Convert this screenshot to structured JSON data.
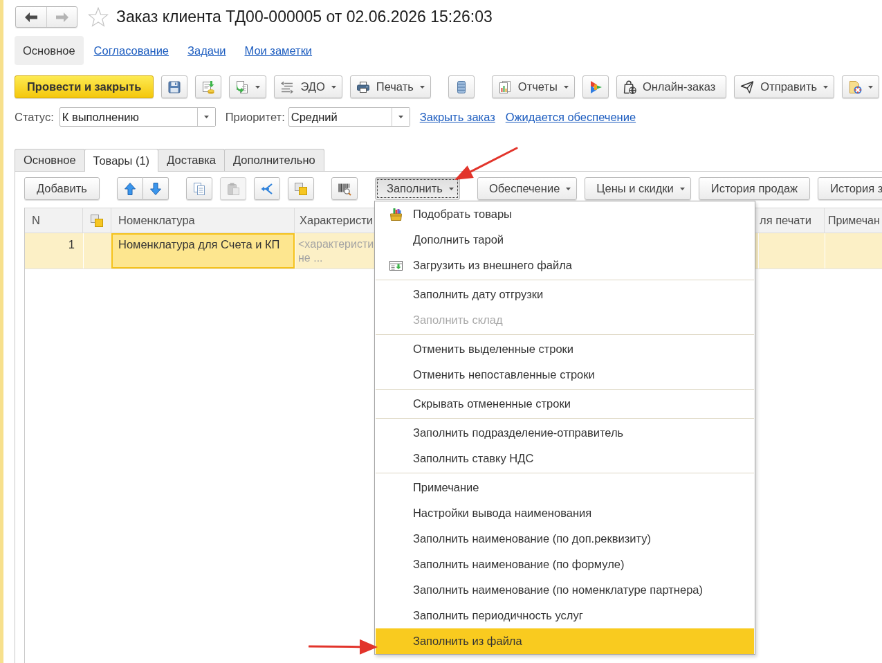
{
  "window": {
    "title": "Заказ клиента ТД00-000005 от 02.06.2026 15:26:03",
    "favorite": false
  },
  "history_buttons": [
    {
      "disabled": false
    },
    {
      "disabled": true
    }
  ],
  "section_tabs": [
    {
      "label": "Основное",
      "selected": true
    },
    {
      "label": "Согласование",
      "selected": false
    },
    {
      "label": "Задачи",
      "selected": false
    },
    {
      "label": "Мои заметки",
      "selected": false
    }
  ],
  "toolbar": {
    "groups": [
      {
        "buttons": [
          {
            "kind": "primary",
            "label": "Провести и закрыть",
            "dropdown": false
          },
          {
            "kind": "icon",
            "dropdown": false
          },
          {
            "kind": "icon",
            "dropdown": false
          },
          {
            "kind": "icon",
            "dropdown": true
          },
          {
            "kind": "icon_text",
            "label": "ЭДО",
            "dropdown": true
          },
          {
            "kind": "icon_text",
            "label": "Печать",
            "dropdown": true
          }
        ]
      },
      {
        "buttons": [
          {
            "kind": "icon",
            "dropdown": false
          }
        ]
      },
      {
        "buttons": [
          {
            "kind": "icon_text",
            "label": "Отчеты",
            "dropdown": true
          },
          {
            "kind": "icon",
            "dropdown": false
          },
          {
            "kind": "icon_text",
            "label": "Онлайн-заказ",
            "dropdown": false
          },
          {
            "kind": "icon_text",
            "label": "Отправить",
            "dropdown": true
          },
          {
            "kind": "icon",
            "dropdown": true
          }
        ]
      }
    ]
  },
  "fields": [
    {
      "label": "Статус:",
      "value": "К выполнению"
    },
    {
      "label": "Приоритет:",
      "value": "Средний"
    }
  ],
  "links": [
    "Закрыть заказ",
    "Ожидается обеспечение"
  ],
  "content_tabs": [
    {
      "label": "Основное",
      "selected": false
    },
    {
      "label": "Товары (1)",
      "selected": true
    },
    {
      "label": "Доставка",
      "selected": false
    },
    {
      "label": "Дополнительно",
      "selected": false
    }
  ],
  "table_toolbar": {
    "groups": [
      {
        "kind": "spaced",
        "buttons": [
          {
            "kind": "text",
            "label": "Добавить",
            "dropdown": false,
            "disabled": false,
            "expanded": false
          }
        ]
      },
      {
        "kind": "joined",
        "buttons": [
          {
            "kind": "icon",
            "dropdown": false,
            "disabled": false,
            "expanded": false
          },
          {
            "kind": "icon",
            "dropdown": false,
            "disabled": false,
            "expanded": false
          }
        ]
      },
      {
        "kind": "spaced",
        "buttons": [
          {
            "kind": "icon",
            "dropdown": false,
            "disabled": false,
            "expanded": false
          },
          {
            "kind": "icon",
            "dropdown": false,
            "disabled": true,
            "expanded": false
          },
          {
            "kind": "icon",
            "dropdown": false,
            "disabled": false,
            "expanded": false
          },
          {
            "kind": "icon",
            "dropdown": false,
            "disabled": false,
            "expanded": false
          }
        ]
      },
      {
        "kind": "spaced",
        "buttons": [
          {
            "kind": "icon",
            "dropdown": false,
            "disabled": false,
            "expanded": false
          }
        ]
      },
      {
        "kind": "spaced",
        "buttons": [
          {
            "kind": "text",
            "label": "Заполнить",
            "dropdown": true,
            "disabled": false,
            "expanded": true,
            "menu": {
              "groups": [
                [
                  {
                    "kind": "icon",
                    "label": "Подобрать товары",
                    "disabled": false,
                    "selected": false
                  },
                  {
                    "kind": "plain",
                    "label": "Дополнить тарой",
                    "disabled": false,
                    "selected": false
                  },
                  {
                    "kind": "icon",
                    "label": "Загрузить из внешнего файла",
                    "disabled": false,
                    "selected": false
                  }
                ],
                [
                  {
                    "kind": "plain",
                    "label": "Заполнить дату отгрузки",
                    "disabled": false,
                    "selected": false
                  },
                  {
                    "kind": "plain",
                    "label": "Заполнить склад",
                    "disabled": true,
                    "selected": false
                  }
                ],
                [
                  {
                    "kind": "plain",
                    "label": "Отменить выделенные строки",
                    "disabled": false,
                    "selected": false
                  },
                  {
                    "kind": "plain",
                    "label": "Отменить непоставленные строки",
                    "disabled": false,
                    "selected": false
                  }
                ],
                [
                  {
                    "kind": "plain",
                    "label": "Скрывать отмененные строки",
                    "disabled": false,
                    "selected": false
                  }
                ],
                [
                  {
                    "kind": "plain",
                    "label": "Заполнить подразделение-отправитель",
                    "disabled": false,
                    "selected": false
                  },
                  {
                    "kind": "plain",
                    "label": "Заполнить ставку НДС",
                    "disabled": false,
                    "selected": false
                  }
                ],
                [
                  {
                    "kind": "plain",
                    "label": "Примечание",
                    "disabled": false,
                    "selected": false
                  },
                  {
                    "kind": "plain",
                    "label": "Настройки вывода наименования",
                    "disabled": false,
                    "selected": false
                  },
                  {
                    "kind": "plain",
                    "label": "Заполнить наименование (по доп.реквизиту)",
                    "disabled": false,
                    "selected": false
                  },
                  {
                    "kind": "plain",
                    "label": "Заполнить наименование (по формуле)",
                    "disabled": false,
                    "selected": false
                  },
                  {
                    "kind": "plain",
                    "label": "Заполнить наименование (по номенклатуре партнера)",
                    "disabled": false,
                    "selected": false
                  },
                  {
                    "kind": "plain",
                    "label": "Заполнить периодичность услуг",
                    "disabled": false,
                    "selected": false
                  },
                  {
                    "kind": "plain",
                    "label": "Заполнить из файла",
                    "disabled": false,
                    "selected": true
                  }
                ]
              ]
            }
          }
        ]
      },
      {
        "kind": "spaced",
        "buttons": [
          {
            "kind": "text",
            "label": "Обеспечение",
            "dropdown": true,
            "disabled": false,
            "expanded": false
          },
          {
            "kind": "text",
            "label": "Цены и скидки",
            "dropdown": true,
            "disabled": false,
            "expanded": false
          },
          {
            "kind": "text",
            "label": "История продаж",
            "dropdown": false,
            "disabled": false,
            "expanded": false
          },
          {
            "kind": "text",
            "label": "История з",
            "dropdown": false,
            "disabled": false,
            "expanded": false
          }
        ]
      }
    ]
  },
  "table": {
    "columns": [
      {
        "kind": "text",
        "label": "N"
      },
      {
        "kind": "icon"
      },
      {
        "kind": "text",
        "label": "Номенклатура"
      },
      {
        "kind": "text",
        "label": "Характеристи"
      },
      {
        "kind": "text",
        "label": "ля печати"
      },
      {
        "kind": "text",
        "label": "Примечан"
      }
    ],
    "rows": [
      {
        "selected": true,
        "cells": [
          {
            "kind": "number",
            "text": "1",
            "focused": false
          },
          {
            "kind": "empty",
            "focused": false
          },
          {
            "kind": "text",
            "text": "Номенклатура для Счета и КП",
            "focused": true
          },
          {
            "kind": "hint",
            "lines": [
              "<характеристи",
              "не ..."
            ],
            "focused": false
          },
          {
            "kind": "empty",
            "focused": false
          },
          {
            "kind": "empty",
            "focused": false
          }
        ]
      }
    ]
  }
}
